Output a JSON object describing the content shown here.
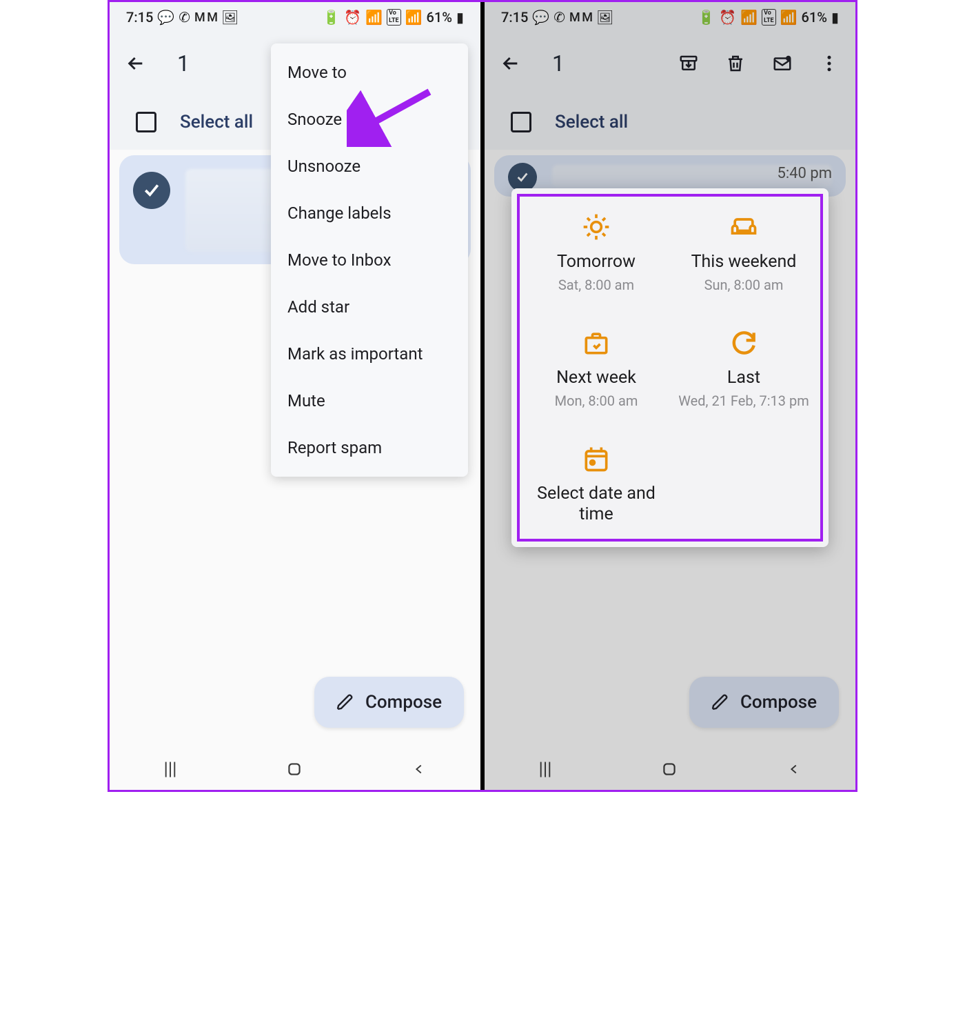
{
  "status": {
    "time": "7:15",
    "battery": "61%"
  },
  "appbar": {
    "count": "1"
  },
  "select": {
    "label": "Select all"
  },
  "email": {
    "time": "5:40 pm"
  },
  "compose": {
    "label": "Compose"
  },
  "menu": {
    "items": [
      "Move to",
      "Snooze",
      "Unsnooze",
      "Change labels",
      "Move to Inbox",
      "Add star",
      "Mark as important",
      "Mute",
      "Report spam"
    ]
  },
  "snooze": {
    "tomorrow": {
      "title": "Tomorrow",
      "sub": "Sat, 8:00 am"
    },
    "weekend": {
      "title": "This weekend",
      "sub": "Sun, 8:00 am"
    },
    "nextweek": {
      "title": "Next week",
      "sub": "Mon, 8:00 am"
    },
    "last": {
      "title": "Last",
      "sub": "Wed, 21 Feb, 7:13 pm"
    },
    "custom": {
      "title": "Select date and time"
    }
  }
}
